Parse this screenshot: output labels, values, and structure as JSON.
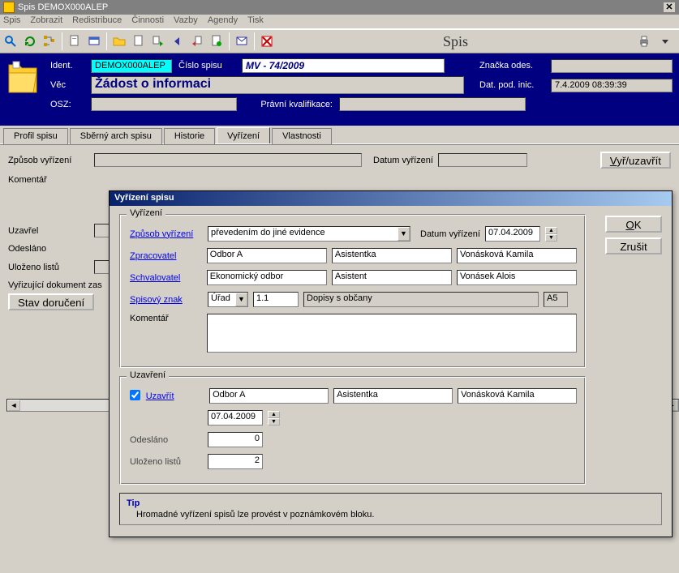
{
  "window": {
    "title": "Spis DEMOX000ALEP"
  },
  "menu": [
    "Spis",
    "Zobrazit",
    "Redistribuce",
    "Činnosti",
    "Vazby",
    "Agendy",
    "Tisk"
  ],
  "toolbar": {
    "center_title": "Spis"
  },
  "header": {
    "ident_label": "Ident.",
    "ident_value": "DEMOX000ALEP",
    "cislo_spisu_label": "Číslo spisu",
    "cislo_spisu_value": "MV - 74/2009",
    "znacka_label": "Značka odes.",
    "znacka_value": "",
    "vec_label": "Věc",
    "vec_value": "Žádost o informaci",
    "dat_label": "Dat. pod. inic.",
    "dat_value": "7.4.2009 08:39:39",
    "osz_label": "OSZ:",
    "osz_value": "",
    "pravni_label": "Právní kvalifikace:",
    "pravni_value": ""
  },
  "tabs": {
    "items": [
      "Profil spisu",
      "Sběrný arch spisu",
      "Historie",
      "Vyřízení",
      "Vlastnosti"
    ],
    "active_index": 3
  },
  "main": {
    "zpusob_label": "Způsob vyřízení",
    "zpusob_value": "",
    "datum_label": "Datum vyřízení",
    "datum_value": "",
    "vy_btn": "Vyř/uzavřít",
    "koment_label": "Komentář",
    "uzavrel_label": "Uzavřel",
    "odeslano_label": "Odesláno",
    "ulozeno_label": "Uloženo listů",
    "vyrizujici_label": "Vyřizující dokument zas",
    "stav_btn": "Stav doručení"
  },
  "dialog": {
    "title": "Vyřízení spisu",
    "ok_btn": "OK",
    "cancel_btn": "Zrušit",
    "vyrizeni": {
      "legend": "Vyřízení",
      "zpusob_label": "Způsob vyřízení",
      "zpusob_value": "převedením do jiné evidence",
      "datum_label": "Datum vyřízení",
      "datum_value": "07.04.2009",
      "zpracovatel_label": "Zpracovatel",
      "zpracovatel_dept": "Odbor A",
      "zpracovatel_role": "Asistentka",
      "zpracovatel_name": "Vonásková Kamila",
      "schvalovatel_label": "Schvalovatel",
      "schvalovatel_dept": "Ekonomický odbor",
      "schvalovatel_role": "Asistent",
      "schvalovatel_name": "Vonásek Alois",
      "spis_znak_label": "Spisový znak",
      "spis_znak_combo": "Úřad",
      "spis_znak_code": "1.1",
      "spis_znak_desc": "Dopisy s občany",
      "spis_znak_tail": "A5",
      "koment_label": "Komentář",
      "koment_value": ""
    },
    "uzavreni": {
      "legend": "Uzavření",
      "uzavrit_label": "Uzavřít",
      "uzavrit_checked": true,
      "dept": "Odbor A",
      "role": "Asistentka",
      "name": "Vonásková Kamila",
      "date": "07.04.2009",
      "odeslano_label": "Odesláno",
      "odeslano_value": "0",
      "ulozeno_label": "Uloženo listů",
      "ulozeno_value": "2"
    },
    "tip": {
      "heading": "Tip",
      "text": "Hromadné vyřízení spisů lze provést v poznámkovém bloku."
    }
  }
}
